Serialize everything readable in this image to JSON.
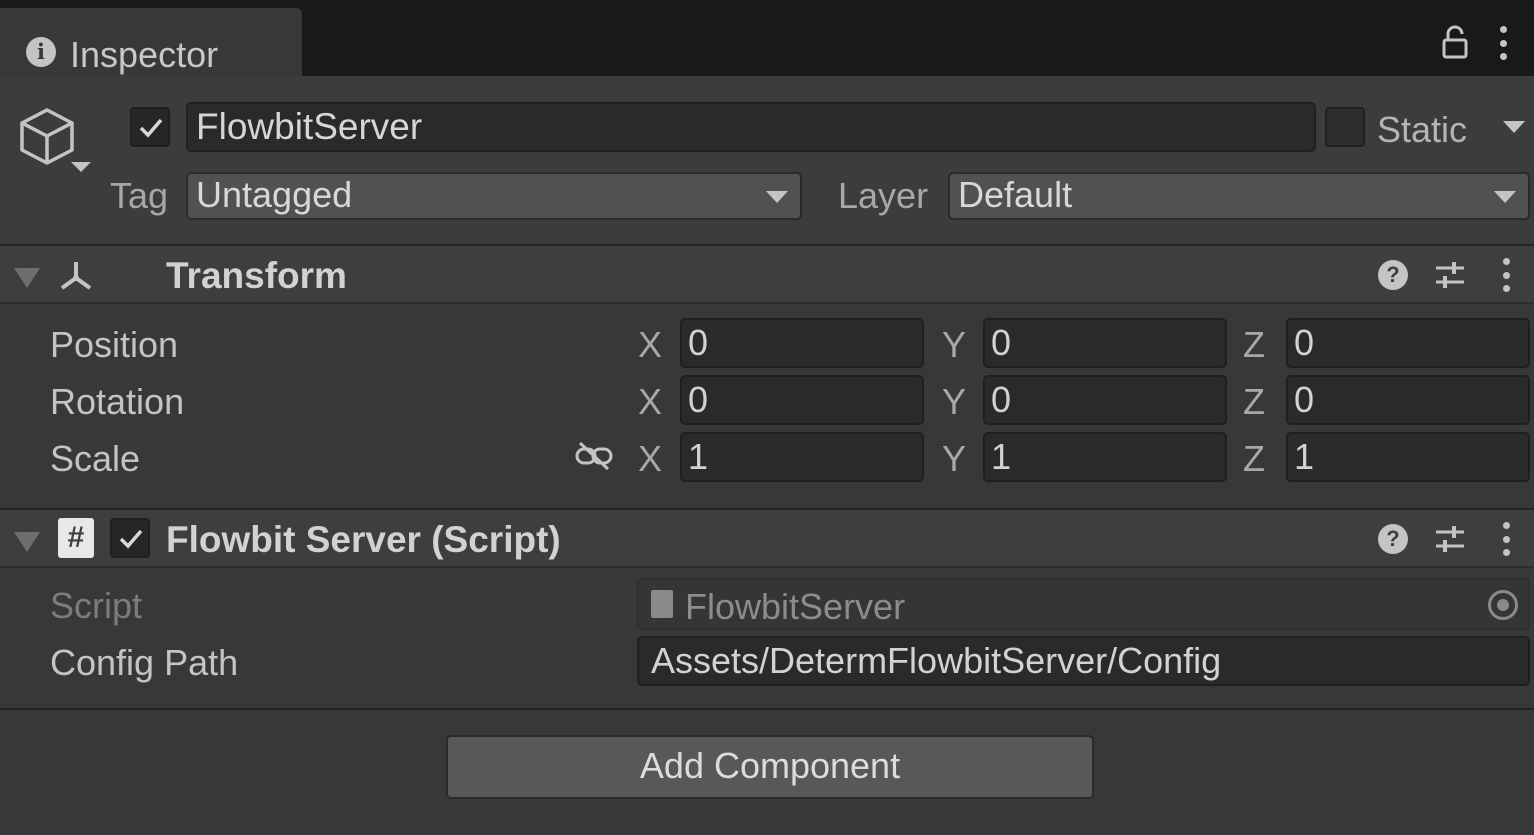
{
  "tab": {
    "label": "Inspector",
    "icon": "info-icon"
  },
  "gameobject": {
    "active": true,
    "name": "FlowbitServer",
    "static_label": "Static",
    "static": false,
    "tag_label": "Tag",
    "tag_value": "Untagged",
    "layer_label": "Layer",
    "layer_value": "Default"
  },
  "transform": {
    "title": "Transform",
    "rows": [
      {
        "label": "Position",
        "x": "0",
        "y": "0",
        "z": "0"
      },
      {
        "label": "Rotation",
        "x": "0",
        "y": "0",
        "z": "0"
      },
      {
        "label": "Scale",
        "x": "1",
        "y": "1",
        "z": "1"
      }
    ],
    "axis_labels": {
      "x": "X",
      "y": "Y",
      "z": "Z"
    }
  },
  "script_component": {
    "title": "Flowbit Server (Script)",
    "enabled": true,
    "script_label": "Script",
    "script_value": "FlowbitServer",
    "config_label": "Config Path",
    "config_value": "Assets/DetermFlowbitServer/Config"
  },
  "add_component": {
    "label": "Add Component"
  },
  "colors": {
    "panel": "#383838",
    "tabbar": "#191919",
    "field": "#2a2a2a",
    "text": "#c4c4c4"
  }
}
